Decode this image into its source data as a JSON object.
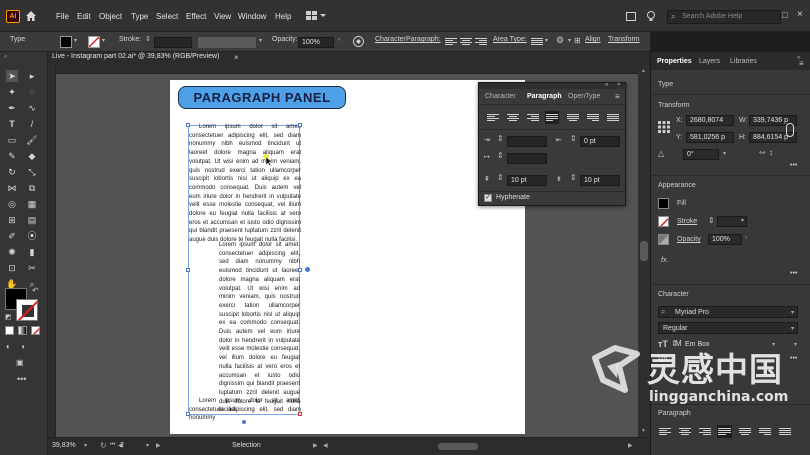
{
  "app": {
    "logo": "Ai"
  },
  "menu": [
    "File",
    "Edit",
    "Object",
    "Type",
    "Select",
    "Effect",
    "View",
    "Window",
    "Help"
  ],
  "search": {
    "placeholder": "Search Adobe Help"
  },
  "control_bar": {
    "type_label": "Type",
    "stroke_label": "Stroke:",
    "opacity_label": "Opacity:",
    "opacity_value": "100%",
    "character_link": "Character",
    "paragraph_link": "Paragraph:",
    "area_type_link": "Area Type:",
    "align_link": "Align",
    "transform_link": "Transform"
  },
  "doc_tab": {
    "title": "Live - Instagram part 02.ai* @ 39,83% (RGB/Preview)",
    "close": "×"
  },
  "artboard": {
    "heading": "PARAGRAPH PANEL",
    "text1": "Lorem ipsum dolor sit amet, consectetuer adipiscing elit, sed diam nonummy nibh euismod tincidunt ut laoreet dolore magna aliquam erat volutpat. Ut wisi enim ad minim veniam, quis nostrud exerci tation ullamcorper suscipit lobortis nisl ut aliquip ex ea commodo consequat. Duis autem vel eum iriure dolor in hendrerit in vulputate velit esse molestie consequat, vel illum dolore eu feugiat nulla facilisis at vero eros et accumsan et iusto odio dignissim qui blandit praesent luptatum zzril delenit augue duis dolore te feugait nulla facilisi.",
    "text2": "Lorem ipsum dolor sit amet, consectetuer adipiscing elit, sed diam nonummy nibh euismod tincidunt ut laoreet dolore magna aliquam erat volutpat. Ut wisi enim ad minim veniam, quis nostrud exerci tation ullamcorper suscipit lobortis nisl ut aliquip ex ea commodo consequat. Duis autem vel eum iriure dolor in hendrerit in vulputate velit esse molestie consequat, vel illum dolore eu feugiat nulla facilisis at vero eros et accumsan et iusto odio dignissim qui blandit praesent luptatum zzril delenit augue duis dolore te feugait nulla facilisi.",
    "text3": "Lorem ipsum dolor sit amet, consectetuer adipiscing elit, sed diam nonummy"
  },
  "paragraph_panel": {
    "tabs": [
      "Character",
      "Paragraph",
      "OpenType"
    ],
    "active_tab": "Paragraph",
    "indent_right": "0 pt",
    "space_before": "10 pt",
    "space_after": "10 pt",
    "hyphenate_label": "Hyphenate",
    "hyphenate_checked": true
  },
  "status_bar": {
    "zoom": "39,83%",
    "artboard_num": "2",
    "tool_name": "Selection"
  },
  "right_panel": {
    "tabs": [
      "Properties",
      "Layers",
      "Libraries"
    ],
    "type_heading": "Type",
    "transform_heading": "Transform",
    "x_label": "X:",
    "x_value": "2680,8074",
    "y_label": "Y:",
    "y_value": "581,0256 p",
    "w_label": "W:",
    "w_value": "339,7436 p",
    "h_label": "H:",
    "h_value": "884,6154 p",
    "rotate_value": "0°",
    "appearance_heading": "Appearance",
    "fill_label": "Fill",
    "stroke_label": "Stroke",
    "opacity_label": "Opacity",
    "opacity_value": "100%",
    "fx_label": "fx.",
    "character_heading": "Character",
    "font_family": "Myriad Pro",
    "font_style": "Regular",
    "em_box": "Em Box",
    "paragraph_heading": "Paragraph"
  },
  "watermark": {
    "brand": "灵感中国",
    "url": "lingganchina.com"
  },
  "colors": {
    "accent": "#4ea1e6",
    "selection": "#4b77d1",
    "ui_dark": "#323232"
  }
}
